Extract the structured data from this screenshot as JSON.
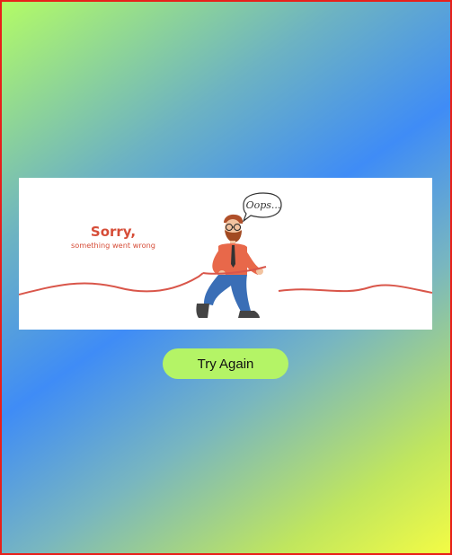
{
  "error_banner": {
    "title": "Sorry,",
    "subtitle": "something went wrong",
    "speech_bubble": "Oops...",
    "accent_color": "#d64d38"
  },
  "actions": {
    "try_again_label": "Try Again",
    "button_color": "#b4f466"
  },
  "page": {
    "border_color": "#e8201a",
    "gradient_colors": [
      "#b3fb66",
      "#3f8cf6",
      "#f3fb45"
    ]
  }
}
